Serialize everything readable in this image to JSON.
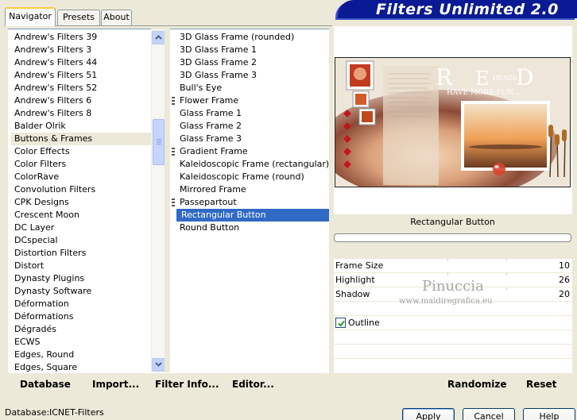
{
  "app": {
    "title": "Filters Unlimited 2.0"
  },
  "tabs": [
    {
      "label": "Navigator",
      "active": true
    },
    {
      "label": "Presets",
      "active": false
    },
    {
      "label": "About",
      "active": false
    }
  ],
  "categories": {
    "items": [
      "Andrew's Filters 39",
      "Andrew's Filters 3",
      "Andrew's Filters 44",
      "Andrew's Filters 51",
      "Andrew's Filters 52",
      "Andrew's Filters 6",
      "Andrew's Filters 8",
      "Balder Olrik",
      "Buttons & Frames",
      "Color Effects",
      "Color Filters",
      "ColorRave",
      "Convolution Filters",
      "CPK Designs",
      "Crescent Moon",
      "DC Layer",
      "DCspecial",
      "Distortion Filters",
      "Distort",
      "Dynasty Plugins",
      "Dynasty Software",
      "Déformation",
      "Déformations",
      "Dégradés",
      "ECWS",
      "Edges, Round",
      "Edges, Square"
    ],
    "selected": "Buttons & Frames"
  },
  "filters": {
    "items": [
      {
        "label": "3D Glass Frame (rounded)",
        "marked": false
      },
      {
        "label": "3D Glass Frame 1",
        "marked": false
      },
      {
        "label": "3D Glass Frame 2",
        "marked": false
      },
      {
        "label": "3D Glass Frame 3",
        "marked": false
      },
      {
        "label": "Bull's Eye",
        "marked": false
      },
      {
        "label": "Flower Frame",
        "marked": true
      },
      {
        "label": "Glass Frame 1",
        "marked": false
      },
      {
        "label": "Glass Frame 2",
        "marked": false
      },
      {
        "label": "Glass Frame 3",
        "marked": false
      },
      {
        "label": "Gradient Frame",
        "marked": true
      },
      {
        "label": "Kaleidoscopic Frame (rectangular)",
        "marked": false
      },
      {
        "label": "Kaleidoscopic Frame (round)",
        "marked": false
      },
      {
        "label": "Mirrored Frame",
        "marked": false
      },
      {
        "label": "Passepartout",
        "marked": true
      },
      {
        "label": "Rectangular Button",
        "marked": false
      },
      {
        "label": "Round Button",
        "marked": false
      }
    ],
    "selected": "Rectangular Button"
  },
  "preview": {
    "filter_name": "Rectangular Button",
    "image_text": {
      "word_r": "R",
      "word_e": "E",
      "word_d": "D",
      "heads": "HEADS",
      "tagline": "HAVE MORE FUN..."
    },
    "accent_colors": {
      "frame": "#c5c2bb",
      "diamond": "#c0181a",
      "sunset": "#f08a30"
    }
  },
  "params": [
    {
      "label": "Frame Size",
      "value": "10"
    },
    {
      "label": "Highlight",
      "value": "26"
    },
    {
      "label": "Shadow",
      "value": "20"
    }
  ],
  "outline": {
    "label": "Outline",
    "checked": true
  },
  "watermark": {
    "line1": "Pinuccia",
    "line2": "www.maidiregrafica.eu"
  },
  "toolbar": {
    "database_label": "Database",
    "import_label": "Import...",
    "filter_info_label": "Filter Info...",
    "editor_label": "Editor...",
    "randomize_label": "Randomize",
    "reset_label": "Reset"
  },
  "status": {
    "database_label": "Database:",
    "database_value": "ICNET-Filters"
  },
  "dialog_buttons": {
    "apply": "Apply",
    "cancel": "Cancel",
    "help": "Help"
  }
}
